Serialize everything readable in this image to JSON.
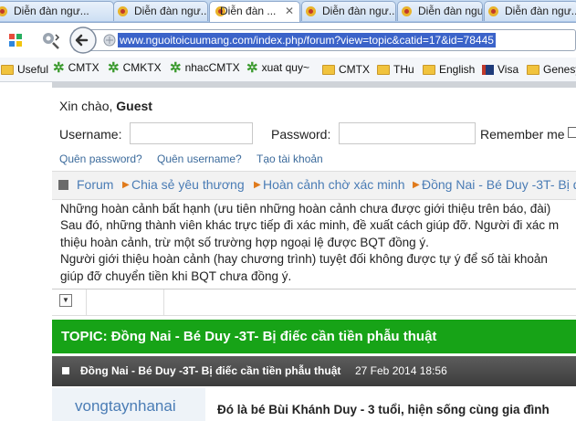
{
  "tabs": [
    {
      "label": "Diễn đàn ngư...",
      "active": false
    },
    {
      "label": "Diễn đàn ngư...",
      "active": false
    },
    {
      "label": "Diễn đàn ...",
      "active": true
    },
    {
      "label": "Diễn đàn ngư...",
      "active": false
    },
    {
      "label": "Diễn đàn ngư...",
      "active": false
    },
    {
      "label": "Diễn đàn ngư...",
      "active": false
    }
  ],
  "address_bar": {
    "url": "www.nguoitoicuumang.com/index.php/forum?view=topic&catid=17&id=78445"
  },
  "bookmarks": [
    "Useful",
    "CMTX",
    "CMKTX",
    "nhacCMTX",
    "xuat quy~",
    "CMTX",
    "THu",
    "English",
    "Visa",
    "Genesys"
  ],
  "login": {
    "greeting": "Xin chào, ",
    "guest": "Guest",
    "username_label": "Username:",
    "password_label": "Password:",
    "remember_label": "Remember me",
    "forgot_password": "Quên password?",
    "forgot_username": "Quên username?",
    "register": "Tạo tài khoản"
  },
  "breadcrumb": [
    "Forum",
    "Chia sẻ yêu thương",
    "Hoàn cảnh chờ xác minh",
    "Đồng Nai - Bé Duy -3T- Bị điếc"
  ],
  "notice": [
    "Những hoàn cảnh bất hạnh (ưu tiên những hoàn cảnh chưa được giới thiệu trên báo, đài)",
    "Sau đó, những thành viên khác trực tiếp đi xác minh, đề xuất cách giúp đỡ. Người đi xác m",
    "thiệu hoàn cảnh, trừ một số trường hợp ngoại lệ được BQT đồng ý.",
    "Người giới thiệu hoàn cảnh (hay chương trình) tuyệt đối không được tự ý để số tài khoản",
    "giúp đỡ chuyển tiền khi BQT chưa đồng ý."
  ],
  "topic": {
    "header": "TOPIC: Đồng Nai - Bé Duy -3T- Bị điếc cần tiền phẫu thuật",
    "post_title": "Đồng Nai - Bé Duy -3T- Bị điếc cần tiền phẫu thuật",
    "post_date": "27 Feb 2014 18:56",
    "author": "vongtaynhanai",
    "post_excerpt": "Đó là bé Bùi Khánh Duy - 3 tuổi, hiện sống cùng gia đình"
  },
  "colors": {
    "green_bar": "#17a317",
    "dark_bar": "#4a4a4a",
    "link": "#3c6b9c",
    "crumb_arrow": "#e07a1b"
  }
}
